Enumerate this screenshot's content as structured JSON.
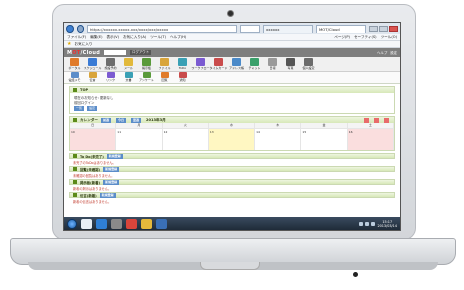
{
  "browser": {
    "address": "https://xxxxxx.xxxxx.xxx/xxxx/xxx/xxxxx",
    "tabs": [
      {
        "label": "xxxxxx",
        "active": false
      },
      {
        "label": "MOT/Cloud",
        "active": true
      }
    ],
    "menu": [
      "ファイル(F)",
      "編集(E)",
      "表示(V)",
      "お気に入り(A)",
      "ツール(T)",
      "ヘルプ(H)"
    ],
    "menu_right": [
      "ページ(P)",
      "セーフティ(S)",
      "ツール(O)"
    ],
    "favorites_label": "お気に入り"
  },
  "app": {
    "logo_main": "M",
    "logo_accent": "OT",
    "logo_rest": "/Cloud",
    "header_btn": "ログアウト",
    "header_right": [
      "ヘルプ",
      "設定"
    ],
    "toolbar": [
      {
        "icon": "home-icon",
        "label": "ポータル",
        "color": "#e07b2a"
      },
      {
        "icon": "calendar-icon",
        "label": "スケジュール",
        "color": "#3a7bd5"
      },
      {
        "icon": "building-icon",
        "label": "施設予約",
        "color": "#6d6d6d"
      },
      {
        "icon": "mail-icon",
        "label": "メール",
        "color": "#e2b93b"
      },
      {
        "icon": "board-icon",
        "label": "掲示板",
        "color": "#5a9a3a"
      },
      {
        "icon": "folder-icon",
        "label": "ファイル",
        "color": "#d9a53b"
      },
      {
        "icon": "todo-icon",
        "label": "ToDo",
        "color": "#3aa0b5"
      },
      {
        "icon": "workflow-icon",
        "label": "ワークフロー",
        "color": "#7b5ad1"
      },
      {
        "icon": "timecard-icon",
        "label": "タイムカード",
        "color": "#c94b4b"
      },
      {
        "icon": "address-icon",
        "label": "アドレス帳",
        "color": "#4b8ac9"
      },
      {
        "icon": "chat-icon",
        "label": "チャット",
        "color": "#3aa06b"
      },
      {
        "icon": "report-icon",
        "label": "日報",
        "color": "#9a9a9a"
      },
      {
        "icon": "camera-icon",
        "label": "写真",
        "color": "#555555"
      },
      {
        "icon": "user-icon",
        "label": "個人設定",
        "color": "#6b6b6b"
      }
    ],
    "subtoolbar": [
      {
        "icon": "phone-icon",
        "label": "電話メモ",
        "color": "#5b8dc9"
      },
      {
        "icon": "memo-icon",
        "label": "伝言",
        "color": "#d9a53b"
      },
      {
        "icon": "link-icon",
        "label": "リンク",
        "color": "#7b5ad1"
      },
      {
        "icon": "doc-icon",
        "label": "文書",
        "color": "#3aa0b5"
      },
      {
        "icon": "survey-icon",
        "label": "アンケート",
        "color": "#5a9a3a"
      },
      {
        "icon": "circular-icon",
        "label": "回覧",
        "color": "#e07b2a"
      },
      {
        "icon": "bell-icon",
        "label": "通知",
        "color": "#c94b4b"
      }
    ]
  },
  "content": {
    "info_panel": {
      "title": "TOP",
      "line1": "現在のお知らせ: 更新なし",
      "line2": "前回ログイン",
      "btn1": "一覧",
      "btn2": "設定"
    },
    "calendar": {
      "title": "カレンダー",
      "nav": [
        "前週",
        "今日",
        "翌週"
      ],
      "month_label": "2013年3月",
      "days": [
        "日",
        "月",
        "火",
        "水",
        "木",
        "金",
        "土"
      ],
      "cells": [
        "10",
        "11",
        "12",
        "13",
        "14",
        "15",
        "16"
      ]
    },
    "sections": [
      {
        "title": "To Do(未完了)",
        "btn": "新規登録",
        "sub": "未完了のToDoはありません。"
      },
      {
        "title": "回覧(未確認)",
        "btn": "新規登録",
        "sub": "未確認の回覧はありません。"
      },
      {
        "title": "掲示板(新着)",
        "btn": "新規登録",
        "sub": "新着の掲示はありません。"
      },
      {
        "title": "伝言(新着)",
        "btn": "新規登録",
        "sub": "新着の伝言はありません。"
      }
    ]
  },
  "taskbar": {
    "time": "15:17",
    "date": "2013/03/14"
  }
}
